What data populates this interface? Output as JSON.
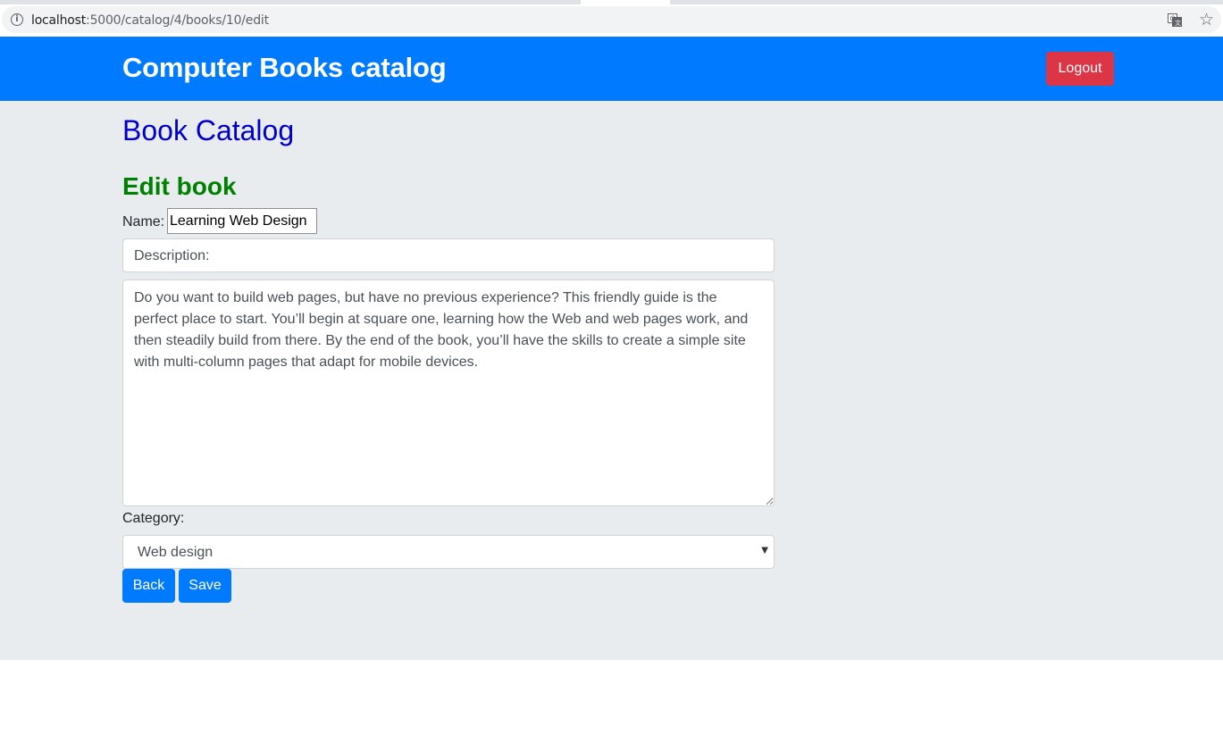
{
  "browser": {
    "url_host": "localhost",
    "url_path": ":5000/catalog/4/books/10/edit"
  },
  "navbar": {
    "brand": "Computer Books catalog",
    "logout_label": "Logout",
    "logout_color": "#dc3545",
    "background_color": "#007bff"
  },
  "main": {
    "page_title": "Book Catalog",
    "section_title": "Edit book",
    "form": {
      "name_label": "Name:",
      "name_value": "Learning Web Design",
      "description_label": "Description:",
      "description_value": "Do you want to build web pages, but have no previous experience? This friendly guide is the perfect place to start. You’ll begin at square one, learning how the Web and web pages work, and then steadily build from there. By the end of the book, you’ll have the skills to create a simple site with multi-column pages that adapt for mobile devices.",
      "category_label": "Category:",
      "category_selected": "Web design",
      "back_label": "Back",
      "save_label": "Save"
    }
  },
  "icons": {
    "info": "info-icon",
    "translate": "translate-icon",
    "bookmark": "star-icon",
    "dropdown": "caret-down-icon"
  }
}
